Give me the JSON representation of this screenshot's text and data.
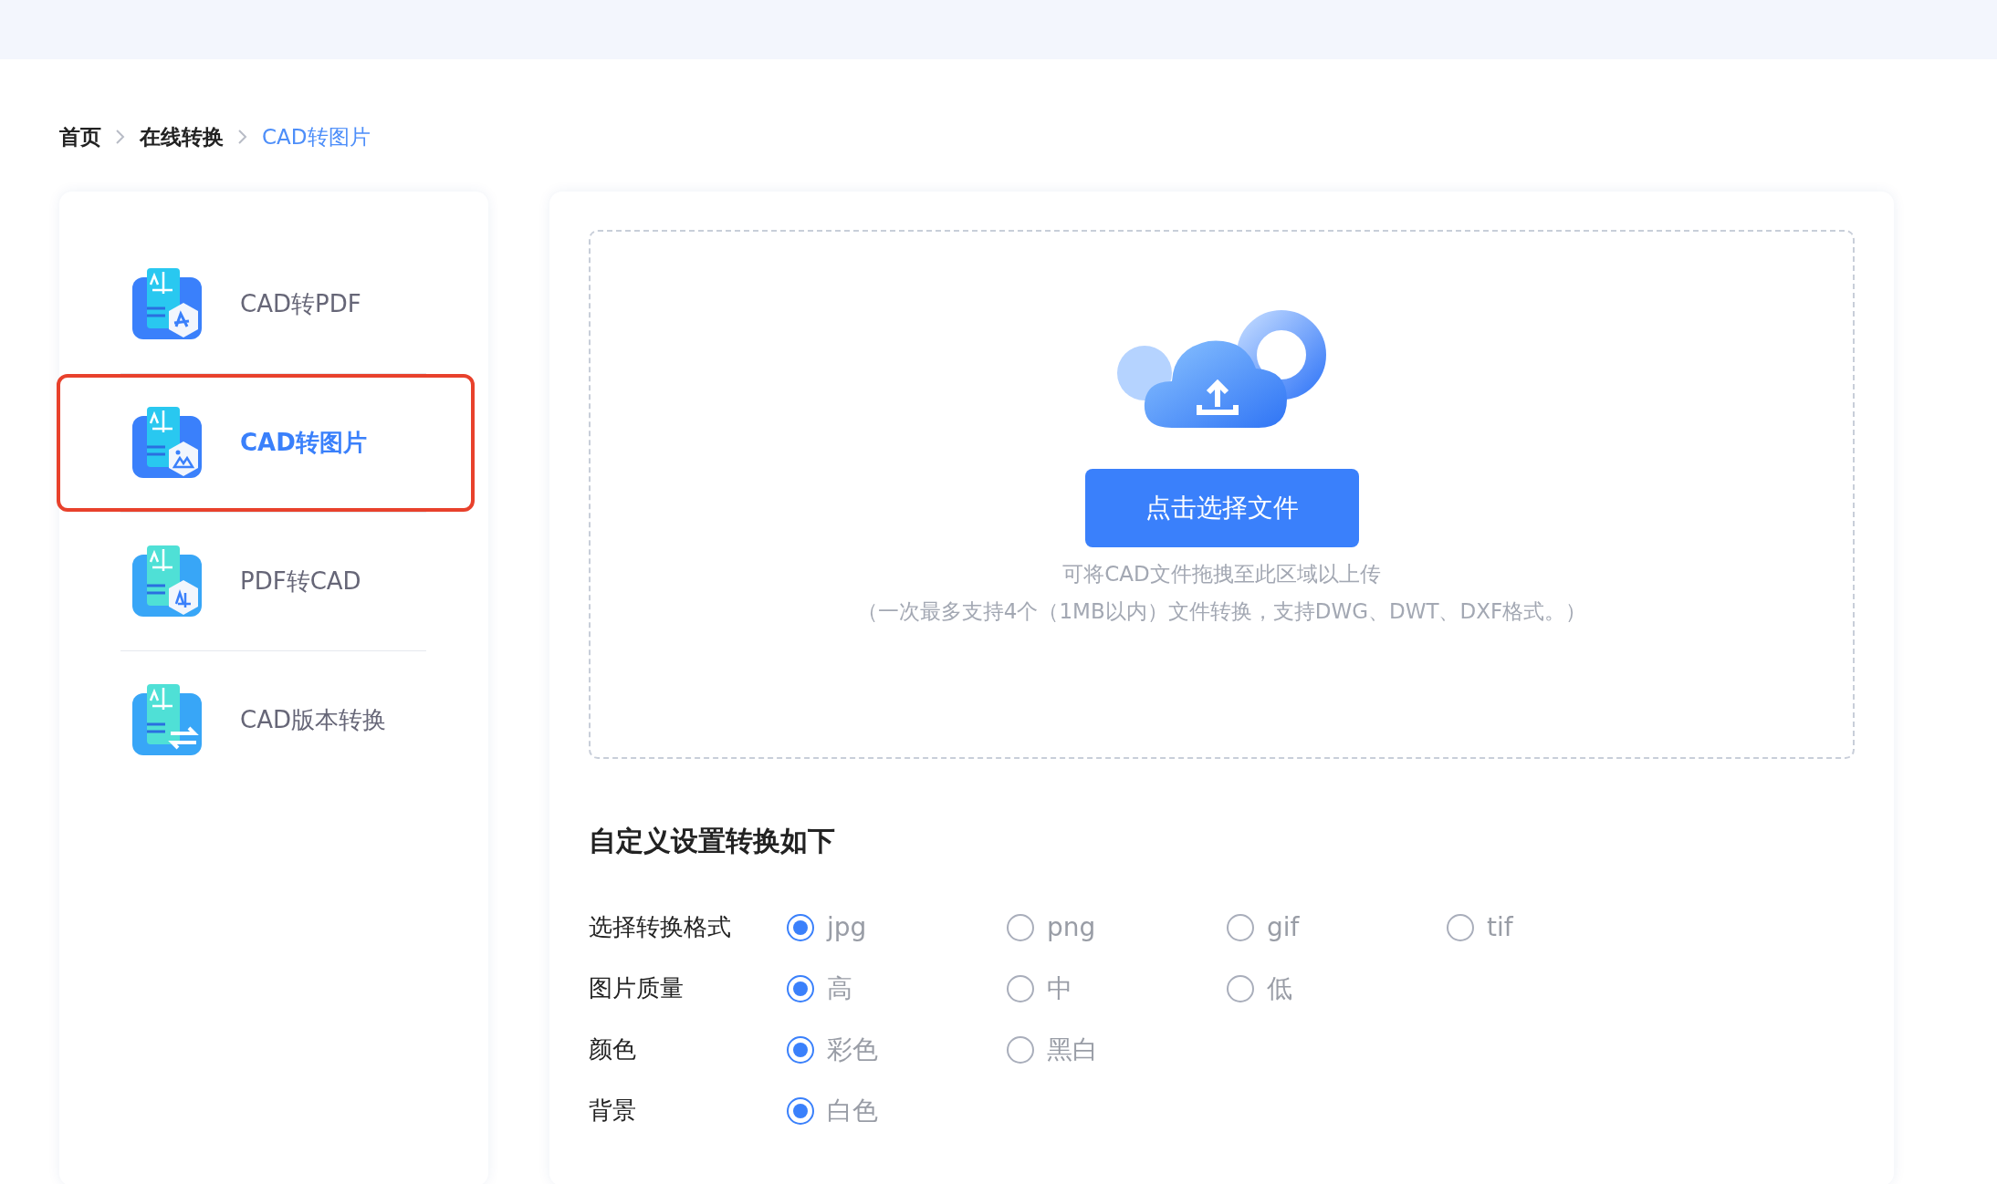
{
  "breadcrumb": [
    {
      "label": "首页",
      "selected": false
    },
    {
      "label": "在线转换",
      "selected": false
    },
    {
      "label": "CAD转图片",
      "selected": true
    }
  ],
  "sidebar": {
    "items": [
      {
        "label": "CAD转PDF",
        "kind": "pdf",
        "selected": false
      },
      {
        "label": "CAD转图片",
        "kind": "image",
        "selected": true
      },
      {
        "label": "PDF转CAD",
        "kind": "cad",
        "selected": false
      },
      {
        "label": "CAD版本转换",
        "kind": "version",
        "selected": false
      }
    ]
  },
  "upload": {
    "button": "点击选择文件",
    "hints": [
      "可将CAD文件拖拽至此区域以上传",
      "（一次最多支持4个（1MB以内）文件转换，支持DWG、DWT、DXF格式。）"
    ]
  },
  "settings": {
    "title": "自定义设置转换如下",
    "rows": [
      {
        "label": "选择转换格式",
        "options": [
          {
            "label": "jpg",
            "selected": true
          },
          {
            "label": "png",
            "selected": false
          },
          {
            "label": "gif",
            "selected": false
          },
          {
            "label": "tif",
            "selected": false
          }
        ]
      },
      {
        "label": "图片质量",
        "options": [
          {
            "label": "高",
            "selected": true
          },
          {
            "label": "中",
            "selected": false
          },
          {
            "label": "低",
            "selected": false
          }
        ]
      },
      {
        "label": "颜色",
        "options": [
          {
            "label": "彩色",
            "selected": true
          },
          {
            "label": "黑白",
            "selected": false
          }
        ]
      },
      {
        "label": "背景",
        "options": [
          {
            "label": "白色",
            "selected": true
          }
        ]
      }
    ]
  }
}
